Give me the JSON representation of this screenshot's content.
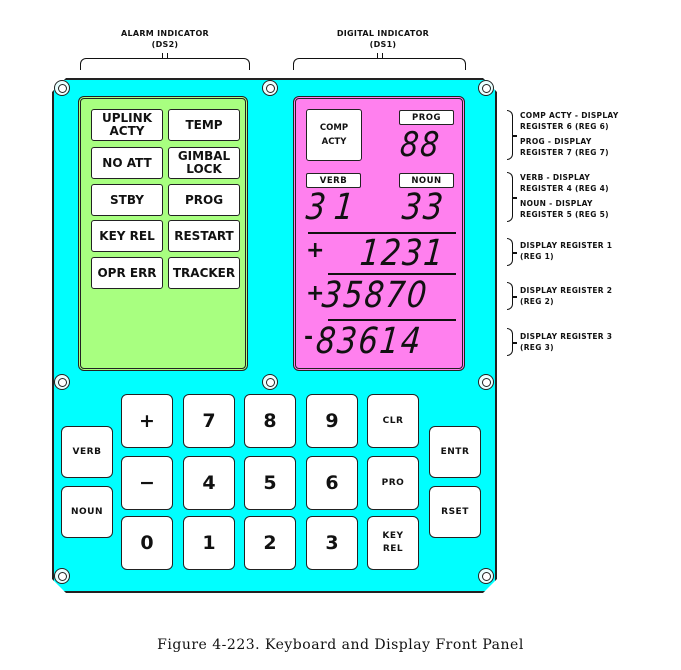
{
  "headers": {
    "alarm": {
      "title": "ALARM INDICATOR",
      "code": "(DS2)"
    },
    "digital": {
      "title": "DIGITAL INDICATOR",
      "code": "(DS1)"
    }
  },
  "alarm_lamps": [
    {
      "label": "UPLINK\nACTY"
    },
    {
      "label": "TEMP"
    },
    {
      "label": "NO ATT"
    },
    {
      "label": "GIMBAL\nLOCK"
    },
    {
      "label": "STBY"
    },
    {
      "label": "PROG"
    },
    {
      "label": "KEY REL"
    },
    {
      "label": "RESTART"
    },
    {
      "label": "OPR ERR"
    },
    {
      "label": "TRACKER"
    }
  ],
  "digital_indicator": {
    "comp_acty": "COMP\nACTY",
    "prog_label": "PROG",
    "prog_value": "88",
    "verb_label": "VERB",
    "verb_value": "31",
    "noun_label": "NOUN",
    "noun_value": "33",
    "registers": [
      {
        "sign": "+",
        "value": "1231"
      },
      {
        "sign": "+",
        "value": "35870"
      },
      {
        "sign": "-",
        "value": "83614"
      }
    ]
  },
  "annotations": [
    {
      "text": "COMP ACTY - DISPLAY\nREGISTER 6  (REG 6)"
    },
    {
      "text": "PROG - DISPLAY\nREGISTER 7  (REG 7)"
    },
    {
      "text": "VERB - DISPLAY\nREGISTER 4  (REG 4)"
    },
    {
      "text": "NOUN - DISPLAY\nREGISTER 5  (REG 5)"
    },
    {
      "text": "DISPLAY REGISTER 1\n(REG 1)"
    },
    {
      "text": "DISPLAY REGISTER 2\n(REG 2)"
    },
    {
      "text": "DISPLAY REGISTER 3\n(REG 3)"
    }
  ],
  "keyboard": {
    "left": [
      "VERB",
      "NOUN"
    ],
    "grid": [
      [
        "+",
        "7",
        "8",
        "9",
        "CLR"
      ],
      [
        "−",
        "4",
        "5",
        "6",
        "PRO"
      ],
      [
        "0",
        "1",
        "2",
        "3",
        "KEY\nREL"
      ]
    ],
    "right": [
      "ENTR",
      "RSET"
    ]
  },
  "caption": "Figure 4-223.  Keyboard and Display Front Panel",
  "colors": {
    "panel": "#00ffff",
    "alarm_bg": "#a8ff80",
    "digital_bg": "#ff80ee"
  }
}
